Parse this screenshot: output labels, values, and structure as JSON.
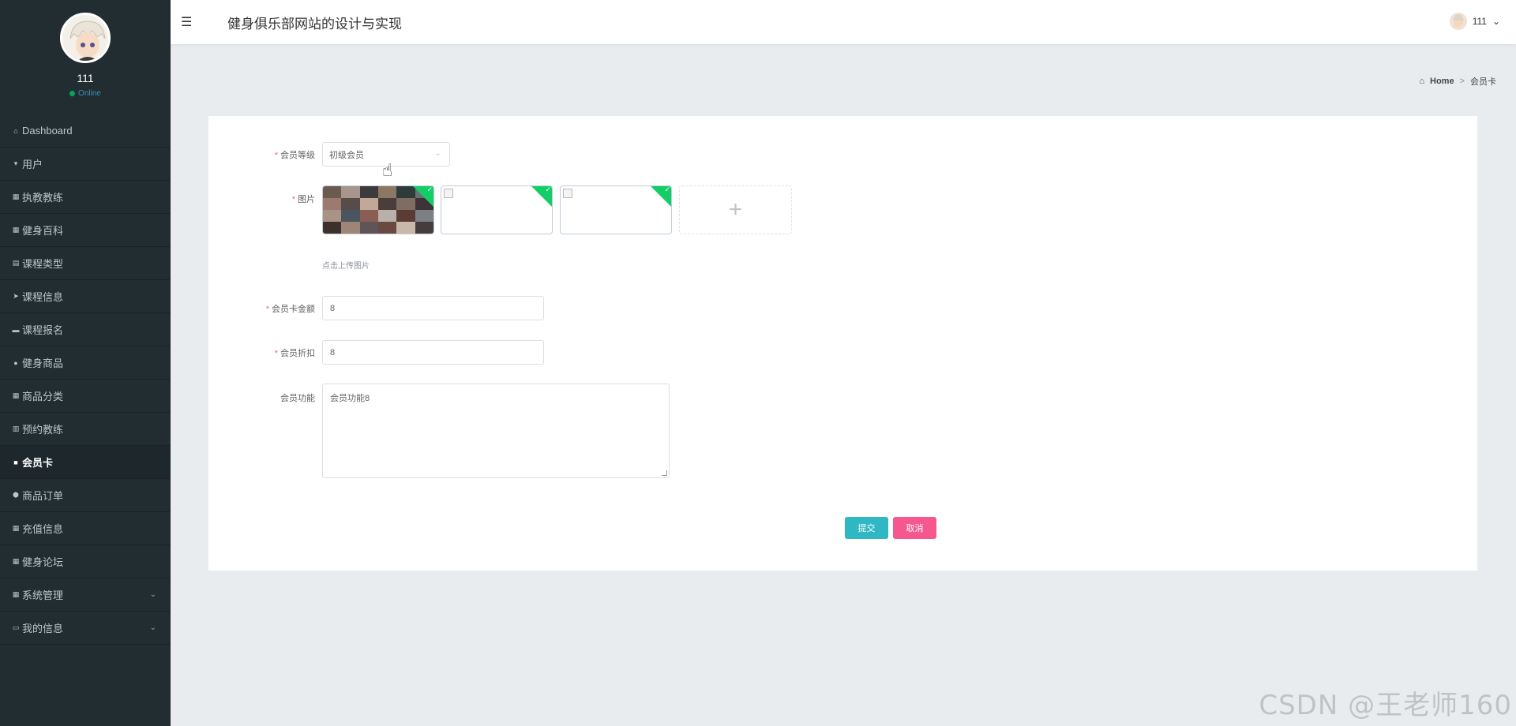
{
  "sidebar": {
    "username": "111",
    "status": "Online",
    "items": [
      {
        "label": "Dashboard",
        "icon": "home-icon",
        "glyph": "⌂"
      },
      {
        "label": "用户",
        "icon": "user-pin-icon",
        "glyph": "▾"
      },
      {
        "label": "执教教练",
        "icon": "grid-icon",
        "glyph": "▦"
      },
      {
        "label": "健身百科",
        "icon": "grid-icon",
        "glyph": "▦"
      },
      {
        "label": "课程类型",
        "icon": "table-icon",
        "glyph": "▤"
      },
      {
        "label": "课程信息",
        "icon": "send-icon",
        "glyph": "➤"
      },
      {
        "label": "课程报名",
        "icon": "bag-icon",
        "glyph": "▬"
      },
      {
        "label": "健身商品",
        "icon": "person-icon",
        "glyph": "●"
      },
      {
        "label": "商品分类",
        "icon": "grid-icon",
        "glyph": "▦"
      },
      {
        "label": "预约教练",
        "icon": "bars-icon",
        "glyph": "▥"
      },
      {
        "label": "会员卡",
        "icon": "card-icon",
        "glyph": "■"
      },
      {
        "label": "商品订单",
        "icon": "shield-icon",
        "glyph": "⬢"
      },
      {
        "label": "充值信息",
        "icon": "grid-icon",
        "glyph": "▦"
      },
      {
        "label": "健身论坛",
        "icon": "grid-icon",
        "glyph": "▦"
      },
      {
        "label": "系统管理",
        "icon": "grid-icon",
        "glyph": "▦"
      },
      {
        "label": "我的信息",
        "icon": "calendar-icon",
        "glyph": "▭"
      }
    ]
  },
  "header": {
    "title": "健身俱乐部网站的设计与实现",
    "user": "111",
    "menu_icon": "menu-icon"
  },
  "breadcrumb": {
    "home": "Home",
    "separator": ">",
    "current": "会员卡"
  },
  "form": {
    "level_label": "会员等级",
    "level_value": "初级会员",
    "image_label": "图片",
    "upload_tip": "点击上传图片",
    "amount_label": "会员卡金额",
    "amount_value": "8",
    "discount_label": "会员折扣",
    "discount_value": "8",
    "function_label": "会员功能",
    "function_value": "会员功能8",
    "submit": "提交",
    "cancel": "取消"
  },
  "colors": {
    "sidebar_bg": "#222d32",
    "submit": "#2fb8c4",
    "cancel": "#f5578f",
    "upload_success": "#13ce66"
  },
  "watermark": "CSDN @王老师160"
}
